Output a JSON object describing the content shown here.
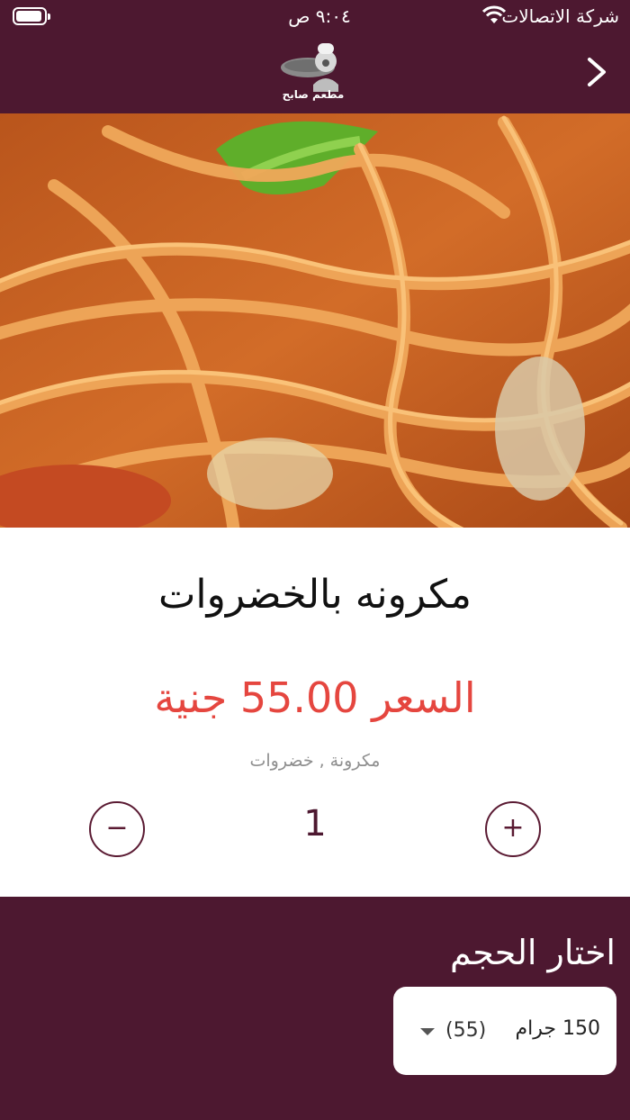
{
  "status_bar": {
    "carrier": "شركة الاتصالات",
    "time": "٩:٠٤ ص"
  },
  "header": {
    "logo_text": "مطعم صابح"
  },
  "product": {
    "title": "مكرونه بالخضروات",
    "price_prefix": "السعر",
    "price_value": "55.00",
    "price_suffix": "جنية",
    "description": "مكرونة , خضروات"
  },
  "quantity": {
    "value": "1",
    "minus_label": "−",
    "plus_label": "+"
  },
  "size": {
    "label": "اختار الحجم",
    "selected_name": "150 جرام",
    "selected_price": "(55)"
  },
  "colors": {
    "brand": "#4d1830",
    "price": "#e5463f"
  }
}
